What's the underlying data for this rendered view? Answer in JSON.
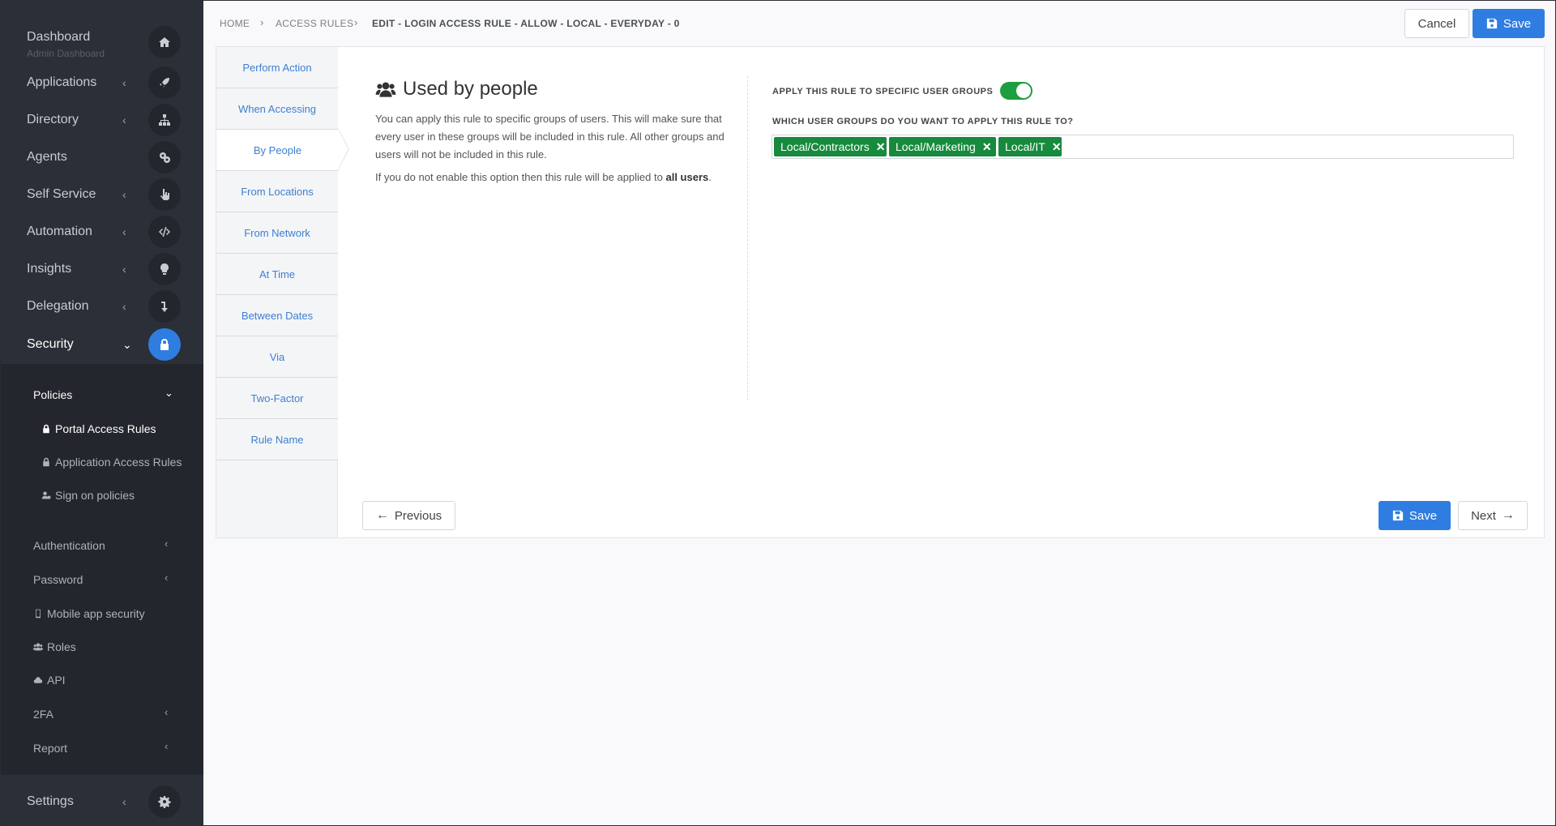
{
  "sidebar": {
    "dashboard": {
      "label": "Dashboard",
      "sub": "Admin Dashboard",
      "icon": "home-icon"
    },
    "items": [
      {
        "label": "Applications",
        "icon": "rocket-icon"
      },
      {
        "label": "Directory",
        "icon": "sitemap-icon"
      },
      {
        "label": "Agents",
        "icon": "cogs-icon"
      },
      {
        "label": "Self Service",
        "icon": "hand-pointer-icon"
      },
      {
        "label": "Automation",
        "icon": "code-icon"
      },
      {
        "label": "Insights",
        "icon": "lightbulb-icon"
      },
      {
        "label": "Delegation",
        "icon": "level-down-icon"
      },
      {
        "label": "Security",
        "icon": "lock-icon"
      }
    ],
    "policies": {
      "label": "Policies",
      "items": [
        "Portal Access Rules",
        "Application Access Rules",
        "Sign on policies"
      ]
    },
    "security_sub": [
      "Authentication",
      "Password",
      "Mobile app security",
      "Roles",
      "API",
      "2FA",
      "Report"
    ],
    "settings": {
      "label": "Settings",
      "icon": "gear-icon"
    }
  },
  "breadcrumb": {
    "home": "HOME",
    "access_rules": "ACCESS RULES",
    "current": "EDIT - LOGIN ACCESS RULE - ALLOW - LOCAL - EVERYDAY - 0"
  },
  "header": {
    "cancel": "Cancel",
    "save": "Save"
  },
  "tabs": [
    "Perform Action",
    "When Accessing",
    "By People",
    "From Locations",
    "From Network",
    "At Time",
    "Between Dates",
    "Via",
    "Two-Factor",
    "Rule Name"
  ],
  "active_tab": "By People",
  "content": {
    "title": "Used by people",
    "description": "You can apply this rule to specific groups of users. This will make sure that every user in these groups will be included in this rule. All other groups and users will not be included in this rule.",
    "note_prefix": "If you do not enable this option then this rule will be applied to",
    "note_bold": "all users",
    "note_suffix": ".",
    "toggle_label": "APPLY THIS RULE TO SPECIFIC USER GROUPS",
    "toggle_on": true,
    "groups_label": "WHICH USER GROUPS DO YOU WANT TO APPLY THIS RULE TO?",
    "groups": [
      "Local/Contractors",
      "Local/Marketing",
      "Local/IT"
    ]
  },
  "footer": {
    "previous": "Previous",
    "save": "Save",
    "next": "Next"
  },
  "colors": {
    "primary": "#2f7de1",
    "tag": "#178a3d",
    "toggle_on": "#1e9e3e",
    "sidebar": "#2b2f37"
  }
}
